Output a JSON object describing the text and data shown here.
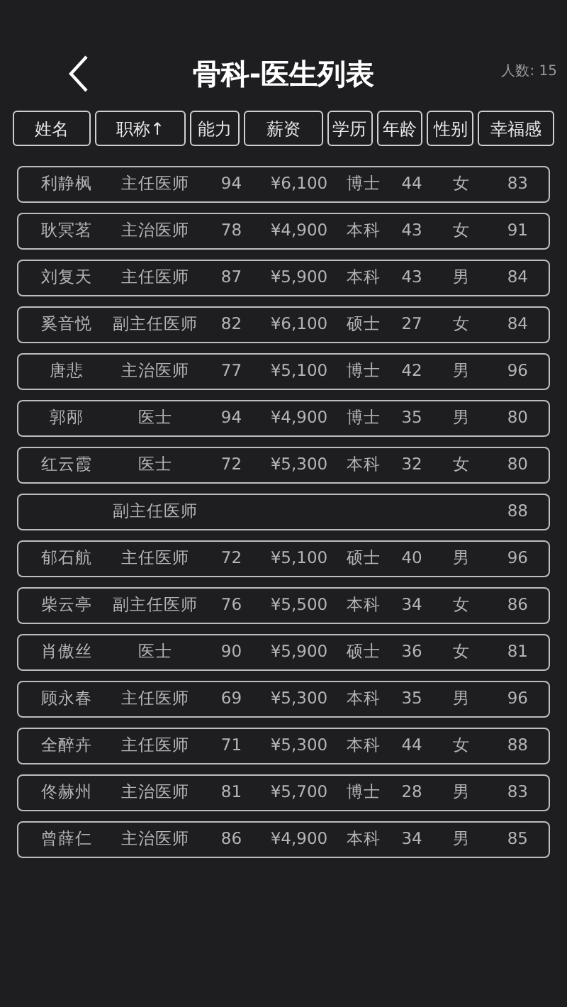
{
  "header": {
    "title": "骨科-医生列表",
    "count": "人数: 15"
  },
  "columns": [
    "姓名",
    "职称↑",
    "能力",
    "薪资",
    "学历",
    "年龄",
    "性别",
    "幸福感"
  ],
  "rows": [
    {
      "name": "利静枫",
      "title": "主任医师",
      "ability": "94",
      "salary": "¥6,100",
      "degree": "博士",
      "age": "44",
      "gender": "女",
      "happiness": "83"
    },
    {
      "name": "耿冥茗",
      "title": "主治医师",
      "ability": "78",
      "salary": "¥4,900",
      "degree": "本科",
      "age": "43",
      "gender": "女",
      "happiness": "91"
    },
    {
      "name": "刘复天",
      "title": "主任医师",
      "ability": "87",
      "salary": "¥5,900",
      "degree": "本科",
      "age": "43",
      "gender": "男",
      "happiness": "84"
    },
    {
      "name": "奚音悦",
      "title": "副主任医师",
      "ability": "82",
      "salary": "¥6,100",
      "degree": "硕士",
      "age": "27",
      "gender": "女",
      "happiness": "84"
    },
    {
      "name": "唐悲",
      "title": "主治医师",
      "ability": "77",
      "salary": "¥5,100",
      "degree": "博士",
      "age": "42",
      "gender": "男",
      "happiness": "96"
    },
    {
      "name": "郭邴",
      "title": "医士",
      "ability": "94",
      "salary": "¥4,900",
      "degree": "博士",
      "age": "35",
      "gender": "男",
      "happiness": "80"
    },
    {
      "name": "红云霞",
      "title": "医士",
      "ability": "72",
      "salary": "¥5,300",
      "degree": "本科",
      "age": "32",
      "gender": "女",
      "happiness": "80"
    },
    {
      "title": "副主任医师",
      "happiness": "88"
    },
    {
      "name": "郁石航",
      "title": "主任医师",
      "ability": "72",
      "salary": "¥5,100",
      "degree": "硕士",
      "age": "40",
      "gender": "男",
      "happiness": "96"
    },
    {
      "name": "柴云亭",
      "title": "副主任医师",
      "ability": "76",
      "salary": "¥5,500",
      "degree": "本科",
      "age": "34",
      "gender": "女",
      "happiness": "86"
    },
    {
      "name": "肖傲丝",
      "title": "医士",
      "ability": "90",
      "salary": "¥5,900",
      "degree": "硕士",
      "age": "36",
      "gender": "女",
      "happiness": "81"
    },
    {
      "name": "顾永春",
      "title": "主任医师",
      "ability": "69",
      "salary": "¥5,300",
      "degree": "本科",
      "age": "35",
      "gender": "男",
      "happiness": "96"
    },
    {
      "name": "全醉卉",
      "title": "主任医师",
      "ability": "71",
      "salary": "¥5,300",
      "degree": "本科",
      "age": "44",
      "gender": "女",
      "happiness": "88"
    },
    {
      "name": "佟赫州",
      "title": "主治医师",
      "ability": "81",
      "salary": "¥5,700",
      "degree": "博士",
      "age": "28",
      "gender": "男",
      "happiness": "83"
    },
    {
      "name": "曾薛仁",
      "title": "主治医师",
      "ability": "86",
      "salary": "¥4,900",
      "degree": "本科",
      "age": "34",
      "gender": "男",
      "happiness": "85"
    }
  ]
}
